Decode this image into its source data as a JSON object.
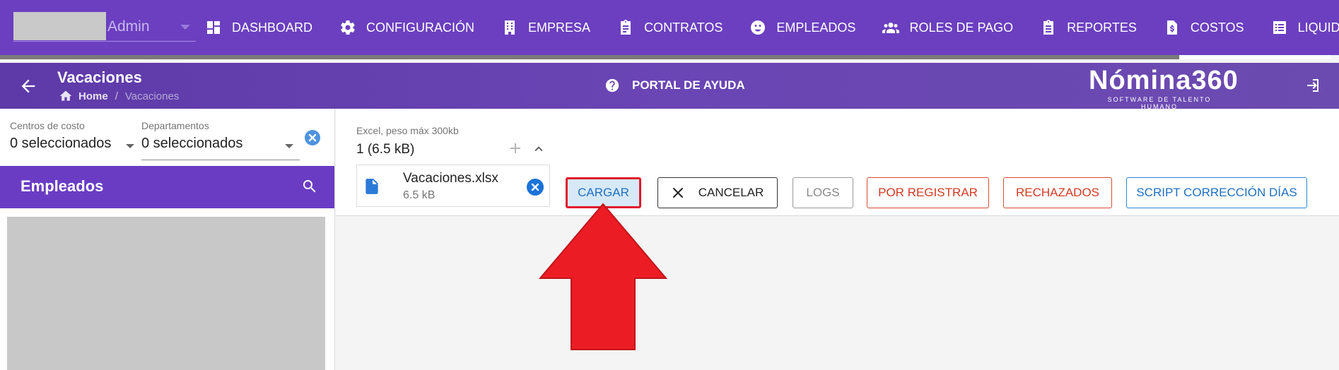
{
  "topbar": {
    "user_name": "Admin",
    "nav": [
      {
        "label": "DASHBOARD",
        "icon": "dashboard-icon"
      },
      {
        "label": "CONFIGURACIÓN",
        "icon": "gear-icon"
      },
      {
        "label": "EMPRESA",
        "icon": "building-icon"
      },
      {
        "label": "CONTRATOS",
        "icon": "clipboard-icon"
      },
      {
        "label": "EMPLEADOS",
        "icon": "face-icon"
      },
      {
        "label": "ROLES DE PAGO",
        "icon": "people-icon"
      },
      {
        "label": "REPORTES",
        "icon": "clipboard-list-icon"
      },
      {
        "label": "COSTOS",
        "icon": "dollar-file-icon"
      },
      {
        "label": "LIQUIDACIONE",
        "icon": "list-icon"
      }
    ]
  },
  "header": {
    "title": "Vacaciones",
    "breadcrumb_home": "Home",
    "breadcrumb_sep": "/",
    "breadcrumb_current": "Vacaciones",
    "help_label": "PORTAL DE AYUDA",
    "brand_name": "Nómina360",
    "brand_tagline": "SOFTWARE DE TALENTO HUMANO"
  },
  "filters": {
    "cost_centers_label": "Centros de costo",
    "cost_centers_value": "0 seleccionados",
    "departments_label": "Departamentos",
    "departments_value": "0 seleccionados"
  },
  "employees": {
    "title": "Empleados"
  },
  "upload": {
    "hint": "Excel, peso máx 300kb",
    "count": "1 (6.5 kB)",
    "file_name": "Vacaciones.xlsx",
    "file_size": "6.5 kB"
  },
  "actions": {
    "cargar": "CARGAR",
    "cancelar": "CANCELAR",
    "logs": "LOGS",
    "por_registrar": "POR REGISTRAR",
    "rechazados": "RECHAZADOS",
    "script": "SCRIPT CORRECCIÓN DÍAS"
  },
  "colors": {
    "primary": "#6b3fc0",
    "highlight": "#e0192b",
    "accent_blue": "#1e6fc2",
    "danger": "#d33a22"
  }
}
